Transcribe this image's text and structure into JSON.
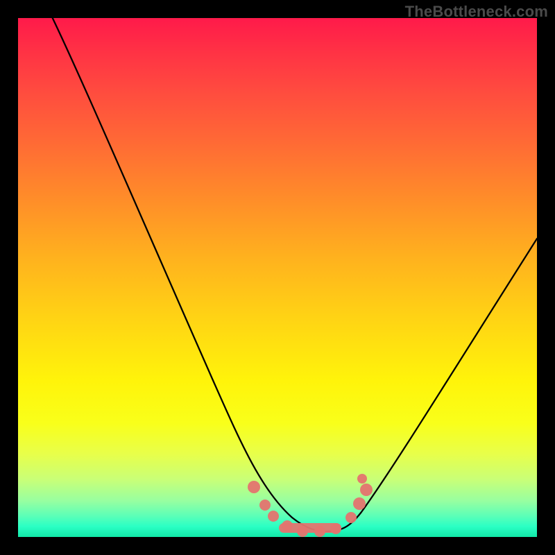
{
  "watermark": "TheBottleneck.com",
  "chart_data": {
    "type": "line",
    "title": "",
    "xlabel": "",
    "ylabel": "",
    "xlim": [
      0,
      100
    ],
    "ylim": [
      0,
      100
    ],
    "x": [
      0,
      5,
      10,
      15,
      20,
      25,
      30,
      35,
      40,
      45,
      48,
      50,
      52,
      55,
      58,
      60,
      62,
      65,
      70,
      75,
      80,
      85,
      90,
      95,
      100
    ],
    "y": [
      100,
      90,
      80,
      70,
      60,
      50,
      40,
      31,
      22,
      13,
      7,
      3,
      1,
      0,
      0,
      0,
      1,
      4,
      10,
      18,
      27,
      36,
      45,
      53,
      62
    ],
    "marker_x": [
      45,
      47,
      49,
      51,
      53,
      55,
      57,
      59,
      61,
      63,
      65
    ],
    "marker_y": [
      6,
      4,
      2,
      1,
      0,
      0,
      0,
      1,
      2,
      4,
      6
    ],
    "notes": "V-shaped bottleneck curve. y axis appears to be bottleneck percentage (0 best, at bottom green band). Minimum around x≈55–60. Pink dots cluster near the trough."
  }
}
